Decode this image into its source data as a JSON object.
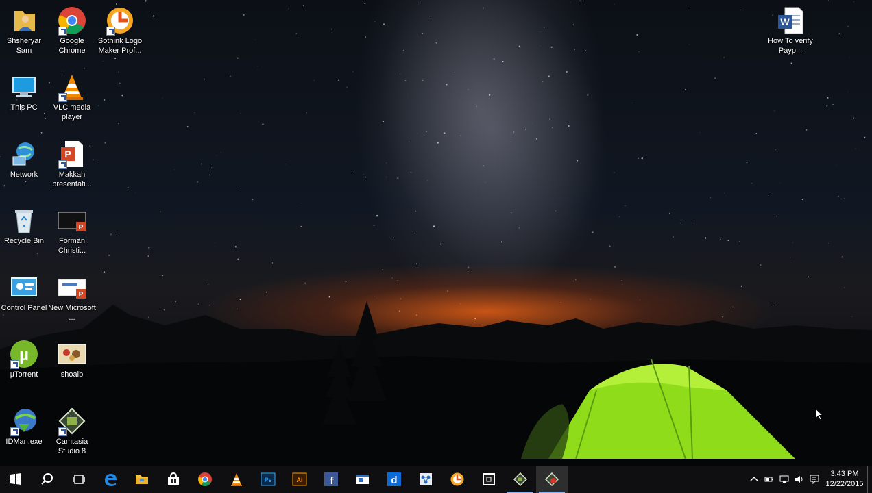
{
  "desktop": {
    "icons": [
      {
        "label": "Shsheryar Sam",
        "icon": "user-folder-icon"
      },
      {
        "label": "Google Chrome",
        "icon": "chrome-icon"
      },
      {
        "label": "Sothink Logo Maker Prof...",
        "icon": "sothink-logo-icon"
      },
      {
        "label": "This PC",
        "icon": "computer-icon"
      },
      {
        "label": "VLC media player",
        "icon": "vlc-icon"
      },
      {
        "label": "Network",
        "icon": "network-icon"
      },
      {
        "label": "Makkah presentati...",
        "icon": "powerpoint-file-icon"
      },
      {
        "label": "Recycle Bin",
        "icon": "recycle-bin-icon"
      },
      {
        "label": "Forman Christi...",
        "icon": "powerpoint-file-icon"
      },
      {
        "label": "Control Panel",
        "icon": "control-panel-icon"
      },
      {
        "label": "New Microsoft ...",
        "icon": "powerpoint-file-icon"
      },
      {
        "label": "µTorrent",
        "icon": "utorrent-icon"
      },
      {
        "label": "shoaib",
        "icon": "image-file-icon"
      },
      {
        "label": "IDMan.exe",
        "icon": "idm-icon"
      },
      {
        "label": "Camtasia Studio 8",
        "icon": "camtasia-icon"
      },
      {
        "label": "How To verify Payp...",
        "icon": "word-file-icon"
      }
    ]
  },
  "taskbar": {
    "buttons": [
      {
        "name": "start",
        "icon": "windows-logo-icon"
      },
      {
        "name": "search",
        "icon": "search-icon"
      },
      {
        "name": "task-view",
        "icon": "task-view-icon"
      },
      {
        "name": "edge",
        "icon": "edge-icon"
      },
      {
        "name": "file-explorer",
        "icon": "folder-icon"
      },
      {
        "name": "store",
        "icon": "store-icon"
      },
      {
        "name": "chrome",
        "icon": "chrome-icon"
      },
      {
        "name": "vlc",
        "icon": "vlc-icon"
      },
      {
        "name": "photoshop",
        "icon": "photoshop-icon",
        "text": "Ps"
      },
      {
        "name": "illustrator",
        "icon": "illustrator-icon",
        "text": "Ai"
      },
      {
        "name": "facebook",
        "icon": "facebook-icon",
        "text": "f"
      },
      {
        "name": "app-blue",
        "icon": "app-window-icon"
      },
      {
        "name": "dailymotion",
        "icon": "dailymotion-icon",
        "text": "d"
      },
      {
        "name": "app-network",
        "icon": "network-app-icon"
      },
      {
        "name": "sothink",
        "icon": "sothink-logo-icon"
      },
      {
        "name": "app-dark",
        "icon": "dark-app-icon"
      },
      {
        "name": "camtasia",
        "icon": "camtasia-icon"
      },
      {
        "name": "camtasia-recorder",
        "icon": "camtasia-recorder-icon"
      }
    ],
    "tray": {
      "icons": [
        "chevron-up-icon",
        "battery-icon",
        "network-tray-icon",
        "volume-icon"
      ],
      "notification_icon": "action-center-icon",
      "time": "3:43 PM",
      "date": "12/22/2015"
    }
  },
  "colors": {
    "taskbar_bg": "#101012",
    "accent": "#8bb4e8",
    "tent_green": "#8fdc1a",
    "horizon_glow": "#e65f14"
  }
}
